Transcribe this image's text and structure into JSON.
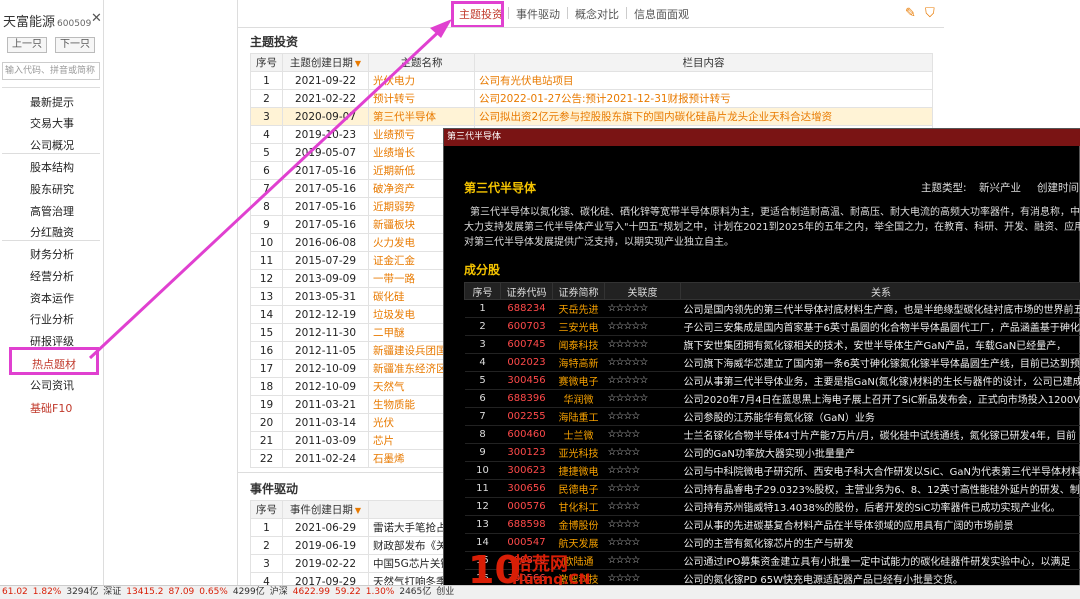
{
  "sidebar": {
    "stock_name": "天富能源",
    "stock_code": "600509",
    "prev_label": "上一只",
    "next_label": "下一只",
    "search_placeholder": "输入代码、拼音或简称",
    "items": [
      "最新提示",
      "交易大事",
      "公司概况",
      "股本结构",
      "股东研究",
      "高管治理",
      "分红融资",
      "财务分析",
      "经营分析",
      "资本运作",
      "行业分析",
      "研报评级"
    ],
    "active_item": "热点题材",
    "after_items": [
      "公司资讯"
    ],
    "red_item": "基础F10"
  },
  "tabs": [
    "主题投资",
    "事件驱动",
    "概念对比",
    "信息面面观"
  ],
  "theme_section": {
    "title": "主题投资",
    "headers": [
      "序号",
      "主题创建日期",
      "主题名称",
      "栏目内容"
    ],
    "rows": [
      [
        "1",
        "2021-09-22",
        "光伏电力",
        "公司有光伏电站项目"
      ],
      [
        "2",
        "2021-02-22",
        "预计转亏",
        "公司2022-01-27公告:预计2021-12-31财报预计转亏"
      ],
      [
        "3",
        "2020-09-07",
        "第三代半导体",
        "公司拟出资2亿元参与控股股东旗下的国内碳化硅晶片龙头企业天科合达增资"
      ],
      [
        "4",
        "2019-10-23",
        "业绩预亏",
        ""
      ],
      [
        "5",
        "2019-05-07",
        "业绩增长",
        ""
      ],
      [
        "6",
        "2017-05-16",
        "近期新低",
        ""
      ],
      [
        "7",
        "2017-05-16",
        "破净资产",
        ""
      ],
      [
        "8",
        "2017-05-16",
        "近期弱势",
        ""
      ],
      [
        "9",
        "2017-05-16",
        "新疆板块",
        ""
      ],
      [
        "10",
        "2016-06-08",
        "火力发电",
        ""
      ],
      [
        "11",
        "2015-07-29",
        "证金汇金",
        ""
      ],
      [
        "12",
        "2013-09-09",
        "一带一路",
        ""
      ],
      [
        "13",
        "2013-05-31",
        "碳化硅",
        ""
      ],
      [
        "14",
        "2012-12-19",
        "垃圾发电",
        ""
      ],
      [
        "15",
        "2012-11-30",
        "二甲醚",
        ""
      ],
      [
        "16",
        "2012-11-05",
        "新疆建设兵团国资",
        ""
      ],
      [
        "17",
        "2012-10-09",
        "新疆准东经济区",
        ""
      ],
      [
        "18",
        "2012-10-09",
        "天然气",
        ""
      ],
      [
        "19",
        "2011-03-21",
        "生物质能",
        ""
      ],
      [
        "20",
        "2011-03-14",
        "光伏",
        ""
      ],
      [
        "21",
        "2011-03-09",
        "芯片",
        ""
      ],
      [
        "22",
        "2011-02-24",
        "石墨烯",
        ""
      ]
    ]
  },
  "event_section": {
    "title": "事件驱动",
    "headers": [
      "序号",
      "事件创建日期"
    ],
    "rows": [
      [
        "1",
        "2021-06-29",
        "雷诺大手笔抢占"
      ],
      [
        "2",
        "2019-06-19",
        "财政部发布《关"
      ],
      [
        "3",
        "2019-02-22",
        "中国5G芯片关键"
      ],
      [
        "4",
        "2017-09-29",
        "天然气打响冬季"
      ]
    ]
  },
  "popup": {
    "window_title": "第三代半导体",
    "heading": "第三代半导体",
    "type_label": "主题类型:",
    "type_value": "新兴产业",
    "created_label": "创建时间:",
    "desc_lines": [
      "第三代半导体以氮化镓、碳化硅、硒化锌等宽带半导体原料为主，更适合制造耐高温、耐高压、耐大电流的高频大功率器件，有消息称，中",
      "大力支持发展第三代半导体产业写入\"十四五\"规划之中，计划在2021到2025年的五年之内，举全国之力，在教育、科研、开发、融资、应用",
      "对第三代半导体发展提供广泛支持，以期实现产业独立自主。"
    ],
    "sub_heading": "成分股",
    "headers": [
      "序号",
      "证券代码",
      "证券简称",
      "关联度",
      "关系"
    ],
    "rows": [
      [
        "1",
        "688234",
        "天岳先进",
        "☆☆☆☆☆",
        "公司是国内领先的第三代半导体衬底材料生产商，也是半绝缘型碳化硅衬底市场的世界前五"
      ],
      [
        "2",
        "600703",
        "三安光电",
        "☆☆☆☆☆",
        "子公司三安集成是国内首家基于6英寸晶圆的化合物半导体晶圆代工厂，产品涵盖基于砷化镓"
      ],
      [
        "3",
        "600745",
        "闻泰科技",
        "☆☆☆☆☆",
        "旗下安世集团拥有氮化镓相关的技术，安世半导体生产GaN产品，车载GaN已经量产，"
      ],
      [
        "4",
        "002023",
        "海特高新",
        "☆☆☆☆☆",
        "公司旗下海威华芯建立了国内第一条6英寸砷化镓氮化镓半导体晶圆生产线，目前已达到预"
      ],
      [
        "5",
        "300456",
        "赛微电子",
        "☆☆☆☆☆",
        "公司从事第三代半导体业务，主要是指GaN(氮化镓)材料的生长与器件的设计，公司已建成"
      ],
      [
        "6",
        "688396",
        "华润微",
        "☆☆☆☆☆",
        "公司2020年7月4日在蓝思黑上海电子展上召开了SiC新品发布会，正式向市场投入1200V"
      ],
      [
        "7",
        "002255",
        "海陆重工",
        "☆☆☆☆",
        "公司参股的江苏能华有氮化镓（GaN）业务"
      ],
      [
        "8",
        "600460",
        "士兰微",
        "☆☆☆☆",
        "士兰名镓化合物半导体4寸片产能7万片/月，碳化硅中试线通线，氮化镓已研发4年，目前"
      ],
      [
        "9",
        "300123",
        "亚光科技",
        "☆☆☆☆",
        "公司的GaN功率放大器实现小批量量产"
      ],
      [
        "10",
        "300623",
        "捷捷微电",
        "☆☆☆☆",
        "公司与中科院微电子研究所、西安电子科大合作研发以SiC、GaN为代表第三代半导体材料"
      ],
      [
        "11",
        "300656",
        "民德电子",
        "☆☆☆☆",
        "公司持有晶睿电子29.0323%股权，主营业务为6、8、12英寸高性能硅外延片的研发、制"
      ],
      [
        "12",
        "000576",
        "甘化科工",
        "☆☆☆☆",
        "公司持有苏州锴威特13.4038%的股份，后者开发的SiC功率器件已成功实现产业化。"
      ],
      [
        "13",
        "688598",
        "金博股份",
        "☆☆☆☆",
        "公司从事的先进碳基复合材料产品在半导体领域的应用具有广阔的市场前景"
      ],
      [
        "14",
        "000547",
        "航天发展",
        "☆☆☆☆",
        "公司的主营有氮化镓芯片的生产与研发"
      ],
      [
        "15",
        "300870",
        "欧陆通",
        "☆☆☆☆",
        "公司通过IPO募集资金建立具有小批量一定中试能力的碳化硅器件研发实验中心，以满足"
      ],
      [
        "16",
        "300566",
        "激智科技",
        "☆☆☆☆",
        "公司的氮化镓PD 65W快充电源适配器产品已经有小批量交货。"
      ],
      [
        "17",
        "603005",
        "晶方科技",
        "☆☆☆☆",
        "公司持有VisIC公司7.94%的股权，是第三代半导体领域GaN（氮化镓）器件的全球领先"
      ]
    ]
  },
  "statusbar": {
    "segments": [
      {
        "t": "61.02",
        "c": "r"
      },
      {
        "t": "1.82%",
        "c": "r"
      },
      {
        "t": "3294亿",
        "c": "k"
      },
      {
        "t": "深证",
        "c": "k"
      },
      {
        "t": "13415.2",
        "c": "r"
      },
      {
        "t": "87.09",
        "c": "r"
      },
      {
        "t": "0.65%",
        "c": "r"
      },
      {
        "t": "4299亿",
        "c": "k"
      },
      {
        "t": "沪深",
        "c": "k"
      },
      {
        "t": "4622.99",
        "c": "r"
      },
      {
        "t": "59.22",
        "c": "r"
      },
      {
        "t": "1.30%",
        "c": "r"
      },
      {
        "t": "2465亿",
        "c": "k"
      },
      {
        "t": "创业",
        "c": "k"
      }
    ]
  },
  "watermark": {
    "ten": "10",
    "cn": "拾荒网",
    "en": "Huang.CN"
  },
  "colors": {
    "accent_red": "#c0392b",
    "highlight": "#e040d0",
    "popup_gold": "#f5c400",
    "stock_code_red": "#ff4a4a"
  }
}
